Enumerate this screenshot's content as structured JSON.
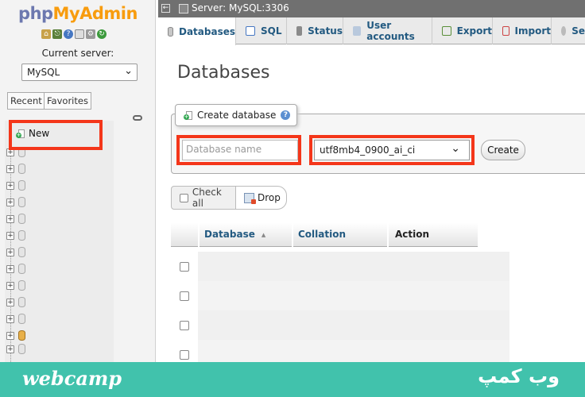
{
  "nav": {
    "logo_php": "php",
    "logo_myadmin": "MyAdmin",
    "current_server_label": "Current server:",
    "server_select_value": "MySQL",
    "tab_recent": "Recent",
    "tab_favorites": "Favorites",
    "tree_new": "New"
  },
  "topbar": {
    "breadcrumb": "Server: MySQL:3306"
  },
  "tabs": {
    "databases": "Databases",
    "sql": "SQL",
    "status": "Status",
    "user_accounts": "User accounts",
    "export": "Export",
    "import": "Import",
    "settings": "Se"
  },
  "main": {
    "title": "Databases",
    "create_legend": "Create database",
    "db_name_placeholder": "Database name",
    "collation_value": "utf8mb4_0900_ai_ci",
    "create_button": "Create",
    "check_all": "Check all",
    "drop_button": "Drop"
  },
  "table": {
    "columns": [
      "Database",
      "Collation",
      "Action"
    ]
  },
  "footer": {
    "brand": "webcamp",
    "brand_fa": "وب کمپ"
  },
  "colors": {
    "accent": "#235a81",
    "highlight": "#f4361a",
    "footer": "#41c2ac"
  }
}
